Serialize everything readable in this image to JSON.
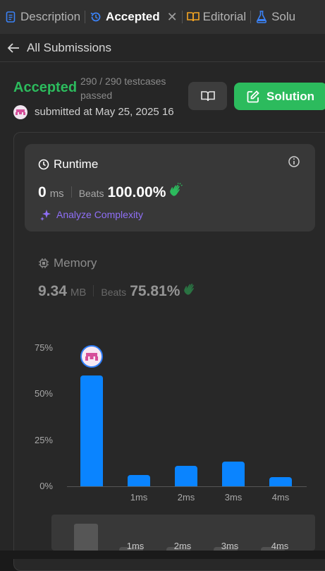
{
  "tabs": [
    {
      "label": "Description",
      "icon": "document-icon",
      "active": false
    },
    {
      "label": "Accepted",
      "icon": "history-icon",
      "active": true,
      "closable": true
    },
    {
      "label": "Editorial",
      "icon": "book-icon",
      "active": false
    },
    {
      "label": "Solu",
      "icon": "flask-icon",
      "active": false
    }
  ],
  "back": {
    "label": "All Submissions"
  },
  "submission": {
    "status": "Accepted",
    "testcases": "290 / 290 testcases passed",
    "submitted": "submitted at May 25, 2025 16:"
  },
  "actions": {
    "solution_label": "Solution"
  },
  "runtime": {
    "title": "Runtime",
    "value": "0",
    "unit": "ms",
    "beats_label": "Beats",
    "beats_value": "100.00%",
    "analyze_label": "Analyze Complexity"
  },
  "memory": {
    "title": "Memory",
    "value": "9.34",
    "unit": "MB",
    "beats_label": "Beats",
    "beats_value": "75.81%"
  },
  "chart_data": {
    "type": "bar",
    "categories": [
      "",
      "1ms",
      "2ms",
      "3ms",
      "4ms"
    ],
    "values": [
      60,
      6,
      11,
      13.5,
      5
    ],
    "yticks": [
      "75%",
      "50%",
      "25%",
      "0%"
    ],
    "ylim": [
      0,
      75
    ],
    "highlight_index": 0
  },
  "mini_chart": {
    "labels": [
      "1ms",
      "2ms",
      "3ms",
      "4ms"
    ]
  },
  "colors": {
    "accent_green": "#2cbb5d",
    "bar_blue": "#0a84ff",
    "analyze_purple": "#8f6ff7"
  }
}
